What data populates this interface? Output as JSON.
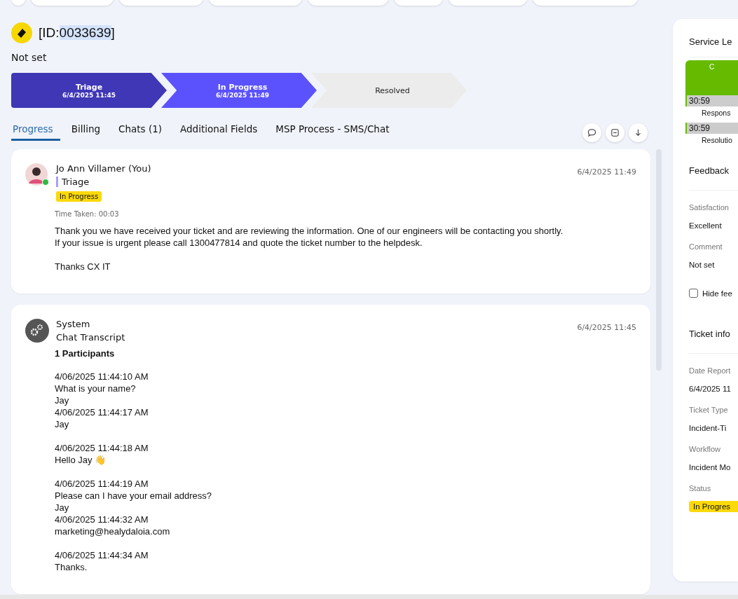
{
  "ticket": {
    "id_prefix": "[ID:",
    "id_number": "0033639",
    "id_suffix": "]",
    "subtitle": "Not set"
  },
  "stages": [
    {
      "label": "Triage",
      "time": "6/4/2025 11:45",
      "completed": true,
      "current": false
    },
    {
      "label": "In Progress",
      "time": "6/4/2025 11:49",
      "completed": false,
      "current": true
    },
    {
      "label": "Resolved",
      "completed": false,
      "current": false
    }
  ],
  "tabs": [
    {
      "label": "Progress",
      "selected": true
    },
    {
      "label": "Billing",
      "selected": false
    },
    {
      "label": "Chats (1)",
      "selected": false
    },
    {
      "label": "Additional Fields",
      "selected": false
    },
    {
      "label": "MSP Process - SMS/Chat",
      "selected": false
    }
  ],
  "actions": [
    {
      "kind": "comment"
    },
    {
      "kind": "collapse"
    },
    {
      "kind": "download"
    }
  ],
  "entries": [
    {
      "kind": "user",
      "author": "Jo Ann Villamer (You)",
      "online": true,
      "stage": "Triage",
      "status": "In Progress",
      "time": "6/4/2025 11:49",
      "time_taken": "Time Taken: 00:03",
      "paragraphs": [
        [
          "Thank you we have received your ticket and are reviewing the information. One of our engineers will be contacting you shortly.",
          "If your issue is urgent please call 1300477814 and quote the ticket number to the helpdesk."
        ],
        [
          "Thanks CX IT"
        ]
      ]
    },
    {
      "kind": "system",
      "author": "System",
      "title": "Chat Transcript",
      "time": "6/4/2025 11:45",
      "heading": "1 Participants",
      "paragraphs": [
        [
          "4/06/2025 11:44:10 AM",
          "What is your name?",
          "Jay",
          "4/06/2025 11:44:17 AM",
          "Jay"
        ],
        [
          "4/06/2025 11:44:18 AM",
          "Hello Jay 👋"
        ],
        [
          "4/06/2025 11:44:19 AM",
          "Please can I have your email address?",
          "Jay",
          "4/06/2025 11:44:32 AM",
          "marketing@healydaloia.com"
        ],
        [
          "4/06/2025 11:44:34 AM",
          "Thanks."
        ]
      ]
    }
  ],
  "side": {
    "sla_title": "Service Le",
    "sla_header": "C",
    "timers": [
      {
        "value": "30:59",
        "label": "Respons"
      },
      {
        "value": "30:59",
        "label": "Resolutio"
      }
    ],
    "feedback_title": "Feedback",
    "feedback_fields": [
      {
        "label": "Satisfaction",
        "value": "Excellent"
      },
      {
        "label": "Comment",
        "value": "Not set"
      }
    ],
    "hide_feedback": {
      "label": "Hide fee",
      "checked": false
    },
    "info_title": "Ticket info",
    "info_fields": [
      {
        "label": "Date Report",
        "value": "6/4/2025 11",
        "kind": "text"
      },
      {
        "label": "Ticket Type",
        "value": "Incident-Ti",
        "kind": "text"
      },
      {
        "label": "Workflow",
        "value": "Incident Mo",
        "kind": "text"
      },
      {
        "label": "Status",
        "value": "In Progres",
        "kind": "badge"
      }
    ]
  }
}
